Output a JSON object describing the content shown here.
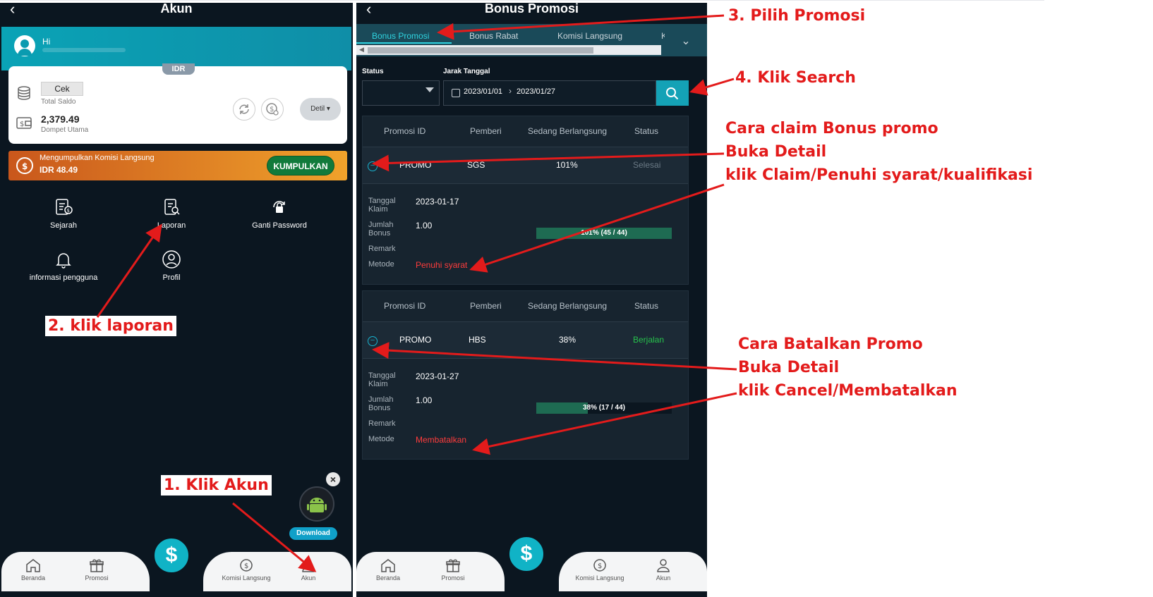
{
  "left_screen": {
    "title": "Akun",
    "greeting": "Hi",
    "currency_tag": "IDR",
    "cek_button": "Cek",
    "total_saldo_label": "Total Saldo",
    "balance": "2,379.49",
    "dompet_label": "Dompet Utama",
    "detil_button": "Detil",
    "komisi_title": "Mengumpulkan Komisi Langsung",
    "komisi_value": "IDR 48.49",
    "kumpulkan_button": "KUMPULKAN",
    "menu": [
      {
        "label": "Sejarah",
        "icon": "history-icon"
      },
      {
        "label": "Laporan",
        "icon": "report-icon"
      },
      {
        "label": "Ganti Password",
        "icon": "lock-icon"
      },
      {
        "label": "informasi pengguna",
        "icon": "bell-icon"
      },
      {
        "label": "Profil",
        "icon": "profile-icon"
      }
    ],
    "download_label": "Download",
    "tabbar": [
      "Beranda",
      "Promosi",
      "Komisi Langsung",
      "Akun"
    ]
  },
  "right_screen": {
    "title": "Bonus Promosi",
    "tabs": [
      "Bonus Promosi",
      "Bonus Rabat",
      "Komisi Langsung",
      "Ko"
    ],
    "status_label": "Status",
    "date_label": "Jarak Tanggal",
    "date_from": "2023/01/01",
    "date_to": "2023/01/27",
    "columns": [
      "Promosi ID",
      "Pemberi",
      "Sedang Berlangsung",
      "Status"
    ],
    "detail_labels": {
      "claim_date": "Tanggal Klaim",
      "bonus_amount": "Jumlah Bonus",
      "remark": "Remark",
      "method": "Metode"
    },
    "records": [
      {
        "promo_id": "PROMO",
        "giver": "SGS",
        "progress": "101%",
        "status": "Selesai",
        "status_color": "#6b7a86",
        "claim_date": "2023-01-17",
        "bonus": "1.00",
        "method": "Penuhi syarat",
        "progress_fraction": 1.0,
        "progress_label": "101% (45 / 44)"
      },
      {
        "promo_id": "PROMO",
        "giver": "HBS",
        "progress": "38%",
        "status": "Berjalan",
        "status_color": "#27c24c",
        "claim_date": "2023-01-27",
        "bonus": "1.00",
        "method": "Membatalkan",
        "progress_fraction": 0.38,
        "progress_label": "38% (17 / 44)"
      }
    ],
    "tabbar": [
      "Beranda",
      "Promosi",
      "Komisi Langsung",
      "Akun"
    ]
  },
  "annotations": {
    "step1": "1. Klik Akun",
    "step2": "2. klik laporan",
    "step3": "3. Pilih Promosi",
    "step4": "4. Klik Search",
    "claim_1": "Cara claim Bonus promo",
    "claim_2": "Buka Detail",
    "claim_3": "klik Claim/Penuhi syarat/kualifikasi",
    "cancel_1": "Cara Batalkan Promo",
    "cancel_2": "Buka Detail",
    "cancel_3": "klik Cancel/Membatalkan"
  },
  "colors": {
    "accent": "#10b3c6",
    "annotation": "#e31b1b",
    "background": "#0b1620"
  }
}
